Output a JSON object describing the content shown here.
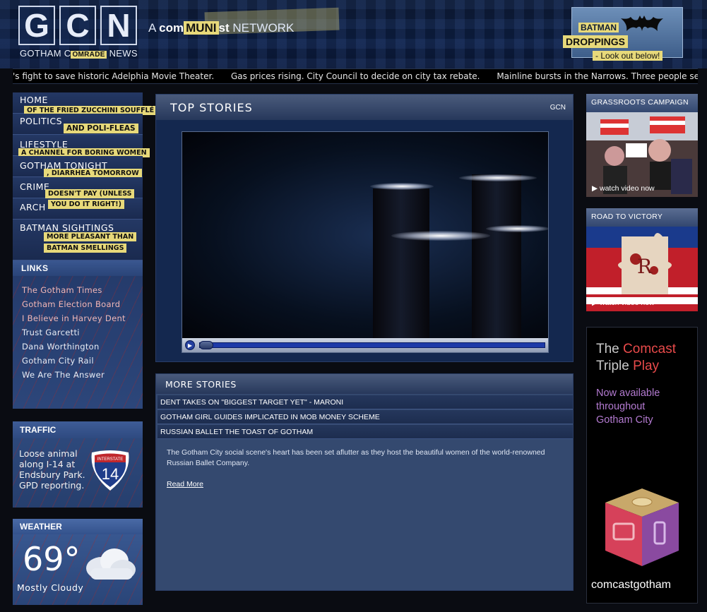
{
  "header": {
    "logo_letters": [
      "G",
      "C",
      "N"
    ],
    "logo_sub_pre": "GOTHAM C",
    "logo_sub_tape": "OMRADE",
    "logo_sub_post": " NEWS",
    "network_a": "A ",
    "network_com": "com",
    "network_tape": "MUNI",
    "network_st": "st",
    "network_post": " NETWORK",
    "batman_line1": "BATMAN",
    "batman_line2": "DROPPINGS",
    "batman_line3": "- Look out below!"
  },
  "ticker": [
    "'s fight to save historic Adelphia Movie Theater.",
    "Gas prices rising. City Council to decide on city tax rebate.",
    "Mainline bursts in the Narrows. Three people seriously in"
  ],
  "nav": [
    {
      "label": "HOME",
      "tape": "OF THE FRIED ZUCCHINI SOUFFLÉ"
    },
    {
      "label": "POLITICS",
      "tape": "AND POLI-FLEAS"
    },
    {
      "label": "LIFESTYLE",
      "tape": "A CHANNEL FOR BORING WOMEN"
    },
    {
      "label": "GOTHAM TONIGHT",
      "tape": ", DIARRHEA TOMORROW"
    },
    {
      "label": "CRIME",
      "tape": "DOESN'T PAY (UNLESS"
    },
    {
      "label": "ARCH",
      "tape": "YOU DO IT RIGHT!)"
    },
    {
      "label": "BATMAN SIGHTINGS",
      "tape": "MORE PLEASANT THAN",
      "tape2": "BATMAN SMELLINGS"
    }
  ],
  "links": {
    "title": "LINKS",
    "items": [
      "The Gotham Times",
      "Gotham Election Board",
      "I Believe in Harvey Dent",
      "Trust Garcetti",
      "Dana Worthington",
      "Gotham City Rail",
      "We Are The Answer"
    ]
  },
  "traffic": {
    "title": "TRAFFIC",
    "text": "Loose animal along I-14 at Endsbury Park. GPD reporting.",
    "shield_label": "INTERSTATE",
    "shield_number": "14"
  },
  "weather": {
    "title": "WEATHER",
    "temp": "69°",
    "condition": "Mostly Cloudy"
  },
  "top_stories": {
    "title": "TOP STORIES",
    "badge": "GCN"
  },
  "more_stories": {
    "title": "MORE STORIES",
    "items": [
      "DENT TAKES ON \"BIGGEST TARGET YET\" - MARONI",
      "GOTHAM GIRL GUIDES IMPLICATED IN MOB MONEY SCHEME",
      "RUSSIAN BALLET THE TOAST OF GOTHAM"
    ],
    "description": "The Gotham City social scene's heart has been set aflutter as they host the beautiful women of the world-renowned Russian Ballet Company.",
    "read_more": "Read More"
  },
  "promos": [
    {
      "title": "GRASSROOTS CAMPAIGN",
      "watch": "▶ watch video now"
    },
    {
      "title": "ROAD TO VICTORY",
      "watch": "▶ watch video now"
    }
  ],
  "comcast": {
    "line1_a": "The ",
    "line1_b": "Comcast",
    "line2_a": "Triple ",
    "line2_b": "Play",
    "now1": "Now available",
    "now2": "throughout",
    "now3": "Gotham City",
    "brand": "comcastgotham"
  }
}
